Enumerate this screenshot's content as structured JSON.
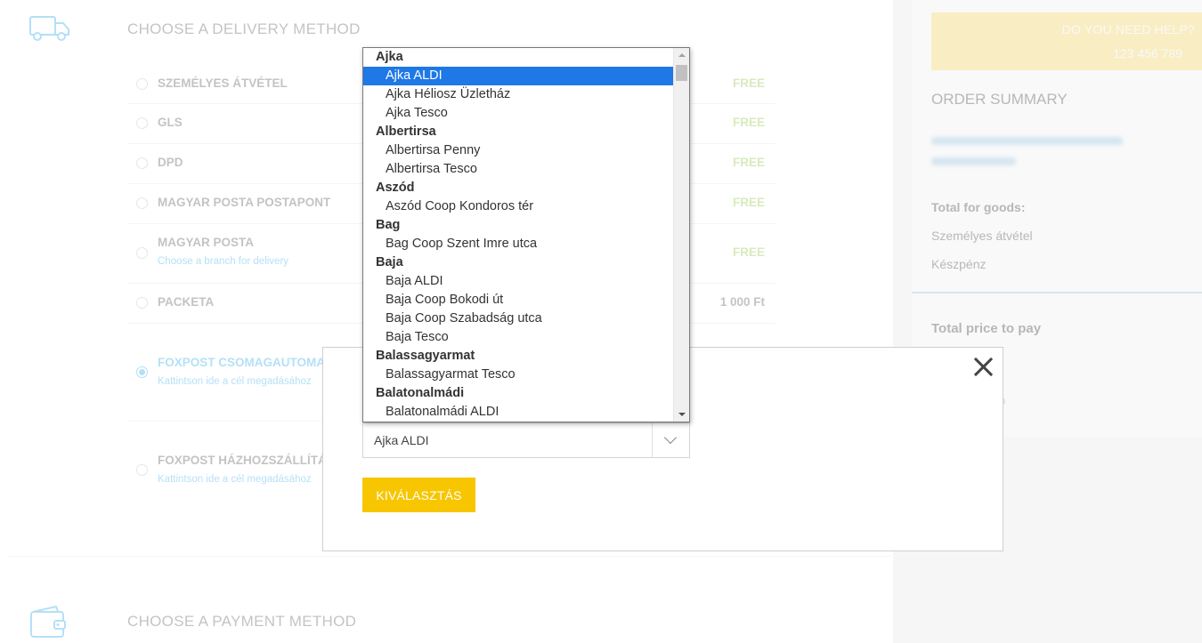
{
  "delivery": {
    "title": "CHOOSE A DELIVERY METHOD",
    "options": [
      {
        "label": "SZEMÉLYES ÁTVÉTEL",
        "sub": "",
        "price": "FREE"
      },
      {
        "label": "GLS",
        "sub": "",
        "price": "FREE"
      },
      {
        "label": "DPD",
        "sub": "",
        "price": "FREE"
      },
      {
        "label": "MAGYAR POSTA POSTAPONT",
        "sub": "",
        "price": "FREE"
      },
      {
        "label": "MAGYAR POSTA",
        "sub": "Choose a branch for delivery",
        "price": "FREE"
      },
      {
        "label": "PACKETA",
        "sub": "",
        "price": "1 000 Ft"
      },
      {
        "label": "FOXPOST CSOMAGAUTOMAT",
        "sub": "Kattintson ide a cél megadásához",
        "price": "",
        "selected": true
      },
      {
        "label": "FOXPOST HÁZHOZSZÁLLÍTÁ",
        "sub": "Kattintson ide a cél megadásához",
        "price": ""
      }
    ]
  },
  "payment": {
    "title": "CHOOSE A PAYMENT METHOD"
  },
  "help": {
    "question": "DO YOU NEED HELP?",
    "phone": "123 456 789"
  },
  "summary": {
    "title": "ORDER SUMMARY",
    "total_goods_label": "Total for goods:",
    "delivery_line": "Személyes átvétel",
    "payment_line": "Készpénz",
    "total_price_label": "Total price to pay",
    "partial_text": "p"
  },
  "modal": {
    "selected_value": "Ajka ALDI",
    "button_label": "KIVÁLASZTÁS"
  },
  "dropdown": {
    "rows": [
      {
        "type": "group",
        "text": "Ajka"
      },
      {
        "type": "item",
        "text": "Ajka ALDI",
        "selected": true
      },
      {
        "type": "item",
        "text": "Ajka Héliosz Üzletház"
      },
      {
        "type": "item",
        "text": "Ajka Tesco"
      },
      {
        "type": "group",
        "text": "Albertirsa"
      },
      {
        "type": "item",
        "text": "Albertirsa Penny"
      },
      {
        "type": "item",
        "text": "Albertirsa Tesco"
      },
      {
        "type": "group",
        "text": "Aszód"
      },
      {
        "type": "item",
        "text": "Aszód Coop Kondoros tér"
      },
      {
        "type": "group",
        "text": "Bag"
      },
      {
        "type": "item",
        "text": "Bag Coop Szent Imre utca"
      },
      {
        "type": "group",
        "text": "Baja"
      },
      {
        "type": "item",
        "text": "Baja ALDI"
      },
      {
        "type": "item",
        "text": "Baja Coop Bokodi út"
      },
      {
        "type": "item",
        "text": "Baja Coop Szabadság utca"
      },
      {
        "type": "item",
        "text": "Baja Tesco"
      },
      {
        "type": "group",
        "text": "Balassagyarmat"
      },
      {
        "type": "item",
        "text": "Balassagyarmat Tesco"
      },
      {
        "type": "group",
        "text": "Balatonalmádi"
      },
      {
        "type": "item",
        "text": "Balatonalmádi ALDI"
      }
    ]
  },
  "colors": {
    "accent": "#29a7e8",
    "free": "#8dc63f",
    "button": "#f7c600",
    "help_bg": "#ffdf66",
    "highlight": "#1e78e6"
  },
  "icons": {
    "delivery": "truck-icon",
    "payment": "wallet-icon",
    "close": "close-icon",
    "select": "chevron-down-icon"
  }
}
